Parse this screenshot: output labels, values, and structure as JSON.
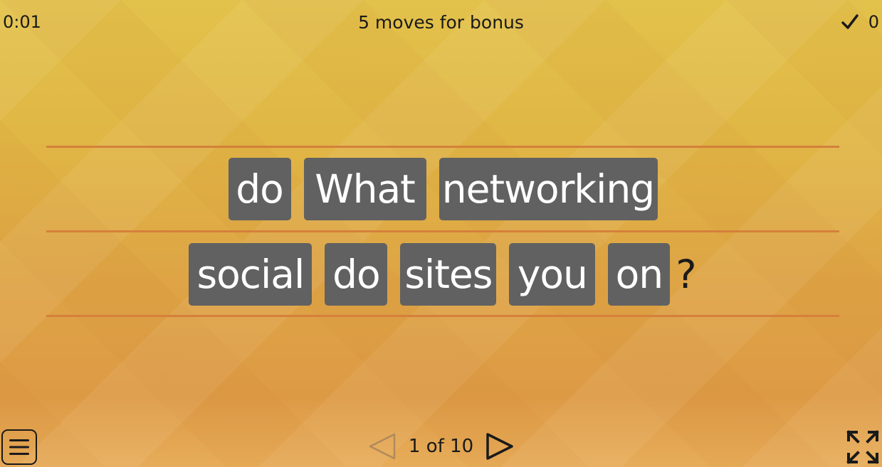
{
  "header": {
    "timer": "0:01",
    "bonus_text": "5 moves for bonus",
    "score": "0",
    "score_icon": "check-icon"
  },
  "puzzle": {
    "row1": [
      "do",
      "What",
      "networking"
    ],
    "row2": [
      "social",
      "do",
      "sites",
      "you",
      "on"
    ],
    "punctuation": "?"
  },
  "footer": {
    "page_label": "1 of 10",
    "prev_icon": "triangle-left-icon",
    "next_icon": "triangle-right-icon",
    "menu_icon": "hamburger-icon",
    "fullscreen_icon": "fullscreen-icon"
  },
  "colors": {
    "tile": "#616161",
    "tile_text": "#ffffff",
    "rule_line": "#d5803a",
    "background_top": "#e2c24a",
    "background_bottom": "#dd9a45"
  }
}
